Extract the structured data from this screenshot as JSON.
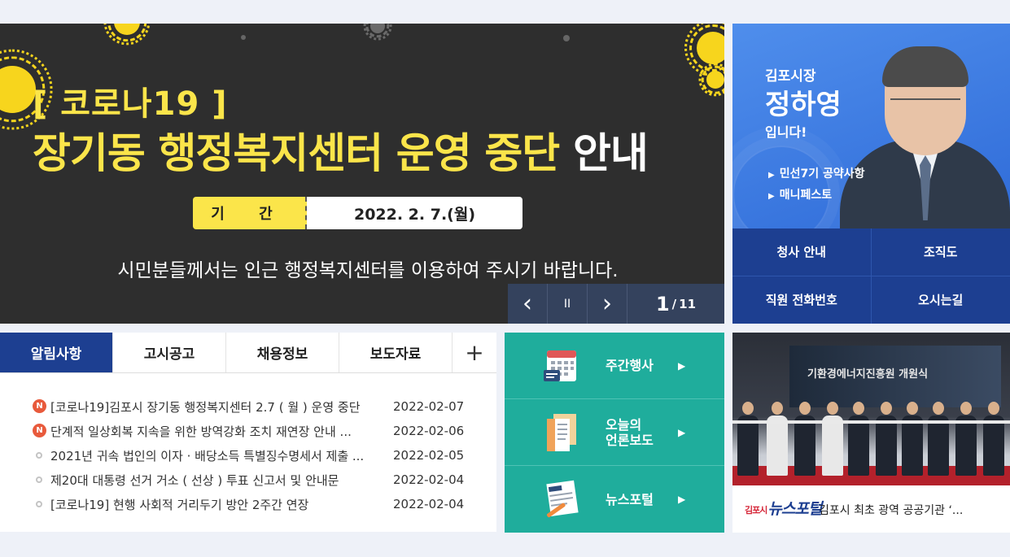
{
  "banner": {
    "tag": "[ 코로나19 ]",
    "title_yellow": "장기동 행정복지센터 운영 중단",
    "title_white": "안내",
    "period_label": "기 간",
    "period_value": "2022. 2. 7.(월)",
    "subtitle": "시민분들께서는 인근 행정복지센터를 이용하여 주시기 바랍니다.",
    "slide_current": "1",
    "slide_separator": "/",
    "slide_total": "11",
    "prev_icon": "‹",
    "pause_icon": "II",
    "next_icon": "›",
    "accent_color": "#fbe54a"
  },
  "mayor": {
    "role": "김포시장",
    "name": "정하영",
    "greeting": "입니다!",
    "links": [
      {
        "label": "민선7기 공약사항"
      },
      {
        "label": "매니페스토"
      }
    ],
    "menu": [
      {
        "label": "청사 안내"
      },
      {
        "label": "조직도"
      },
      {
        "label": "직원 전화번호"
      },
      {
        "label": "오시는길"
      }
    ],
    "brand_color": "#1d3f91"
  },
  "board": {
    "tabs": [
      {
        "label": "알림사항"
      },
      {
        "label": "고시공고"
      },
      {
        "label": "채용정보"
      },
      {
        "label": "보도자료"
      }
    ],
    "more_icon": "+",
    "new_badge": "N",
    "items": [
      {
        "title": "[코로나19]김포시 장기동 행정복지센터 2.7 ( 월 ) 운영 중단",
        "date": "2022-02-07",
        "is_new": true
      },
      {
        "title": "단계적 일상회복 지속을 위한 방역강화 조치 재연장 안내 ...",
        "date": "2022-02-06",
        "is_new": true
      },
      {
        "title": "2021년 귀속 법인의 이자 · 배당소득 특별징수명세서 제출 ...",
        "date": "2022-02-05",
        "is_new": false
      },
      {
        "title": "제20대 대통령 선거 거소 ( 선상 ) 투표 신고서 및 안내문",
        "date": "2022-02-04",
        "is_new": false
      },
      {
        "title": "[코로나19] 현행 사회적 거리두기 방안 2주간 연장",
        "date": "2022-02-04",
        "is_new": false
      }
    ]
  },
  "quick": {
    "items": [
      {
        "label": "주간행사",
        "icon": "calendar-icon"
      },
      {
        "label": "오늘의\n언론보도",
        "icon": "document-icon"
      },
      {
        "label": "뉴스포털",
        "icon": "newspaper-icon"
      }
    ],
    "arrow": "▶",
    "color": "#1fad9c"
  },
  "portal": {
    "logo_small": "김포시",
    "logo_main": "뉴스포털",
    "caption": "김포시 최초 광역 공공기관 ‘...",
    "screen_text": "기환경에너지진흥원 개원식"
  }
}
